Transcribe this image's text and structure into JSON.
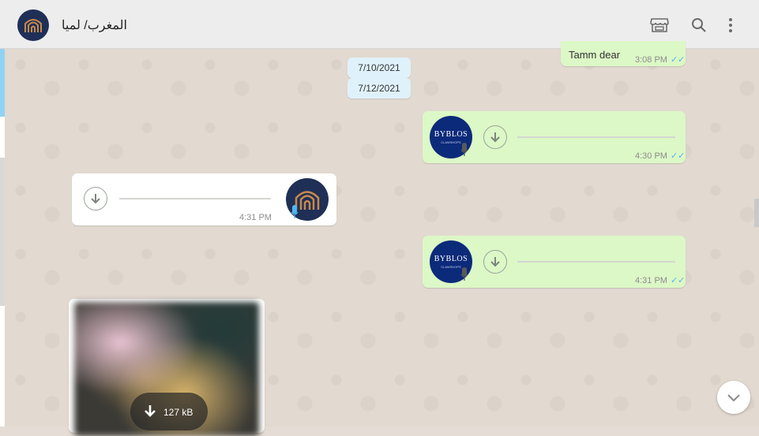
{
  "header": {
    "title": "المغرب/ لميا",
    "icons": [
      "store-icon",
      "search-icon",
      "menu-icon"
    ]
  },
  "messages": {
    "m1": {
      "text": "Tamm dear",
      "time": "3:08 PM",
      "status": "read"
    },
    "dates": [
      "7/10/2021",
      "7/12/2021"
    ],
    "voice1": {
      "time": "4:30 PM",
      "avatar_text": "BYBLOS",
      "avatar_sub": "CLAWSHOPS"
    },
    "voice2": {
      "time": "4:31 PM"
    },
    "voice3": {
      "time": "4:31 PM",
      "avatar_text": "BYBLOS",
      "avatar_sub": "CLAWSHOPS"
    },
    "image": {
      "size": "127 kB"
    }
  },
  "colors": {
    "outgoing": "#dcf8c6",
    "incoming": "#ffffff",
    "read_ticks": "#4fb6ec",
    "header": "#ededed"
  }
}
